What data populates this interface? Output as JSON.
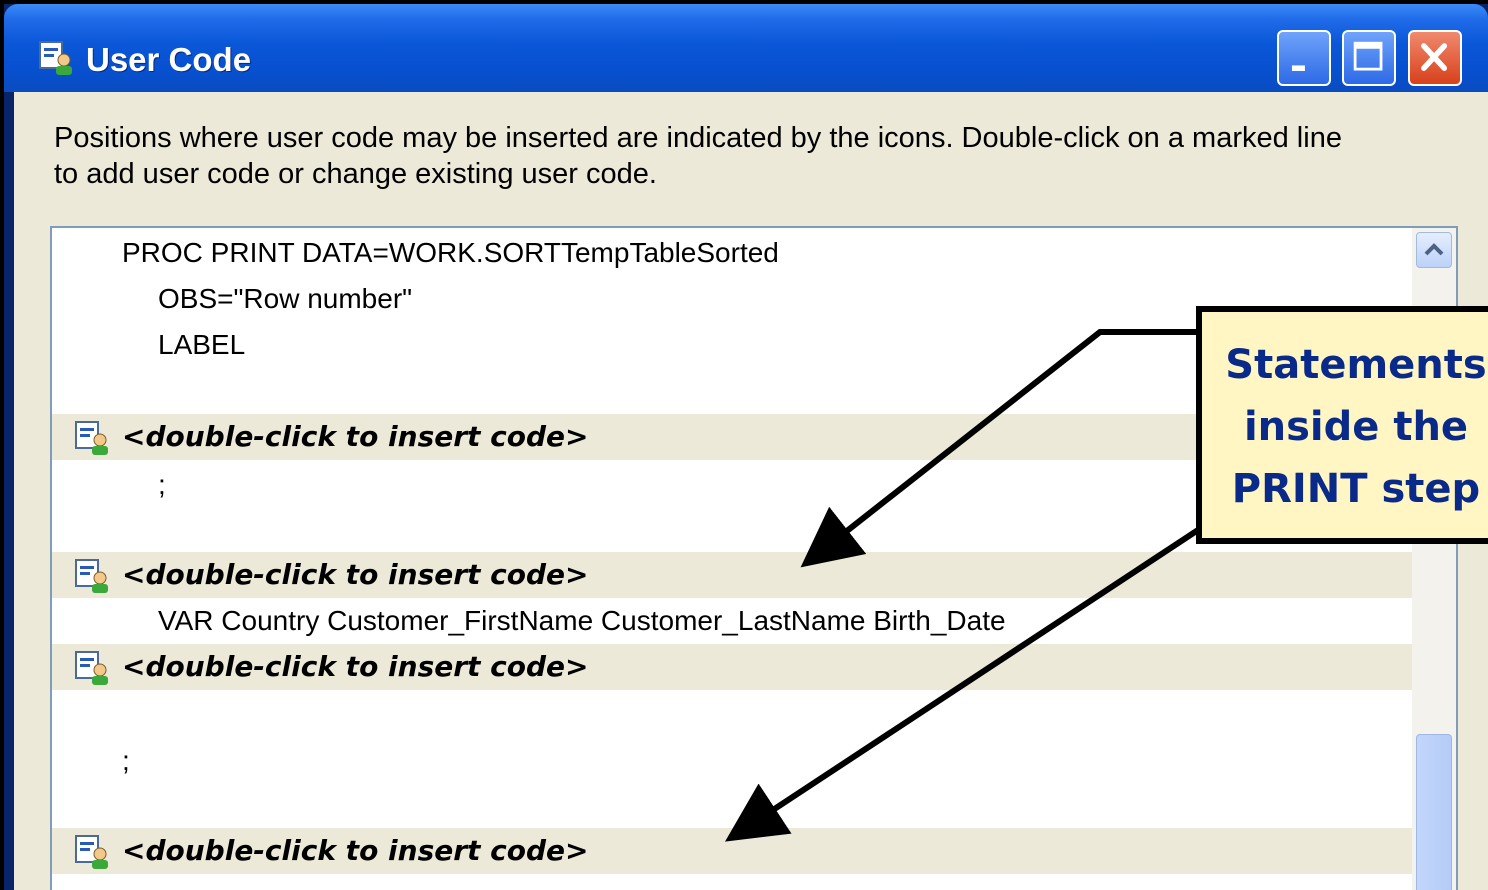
{
  "window": {
    "title": "User Code",
    "buttons": {
      "minimize": "minimize-icon",
      "maximize": "maximize-icon",
      "close": "close-icon"
    }
  },
  "description": "Positions where user code may be inserted are indicated by the icons. Double-click on a marked line to add user code or change existing user code.",
  "code_lines": {
    "l1": "PROC PRINT DATA=WORK.SORTTempTableSorted",
    "l2": "OBS=\"Row number\"",
    "l3": "LABEL",
    "m1": "<double-click to insert code>",
    "l4": ";",
    "m2": "<double-click to insert code>",
    "l5": "VAR Country Customer_FirstName Customer_LastName Birth_Date",
    "m3": "<double-click to insert code>",
    "l6": ";",
    "m4": "<double-click to insert code>"
  },
  "callout": {
    "line1": "Statements",
    "line2": "inside the",
    "line3": "PRINT step"
  },
  "colors": {
    "title_bar": "#0750d0",
    "dialog_bg": "#ece9d8",
    "callout_bg": "#fff6c4",
    "callout_text": "#0a2a8a"
  }
}
